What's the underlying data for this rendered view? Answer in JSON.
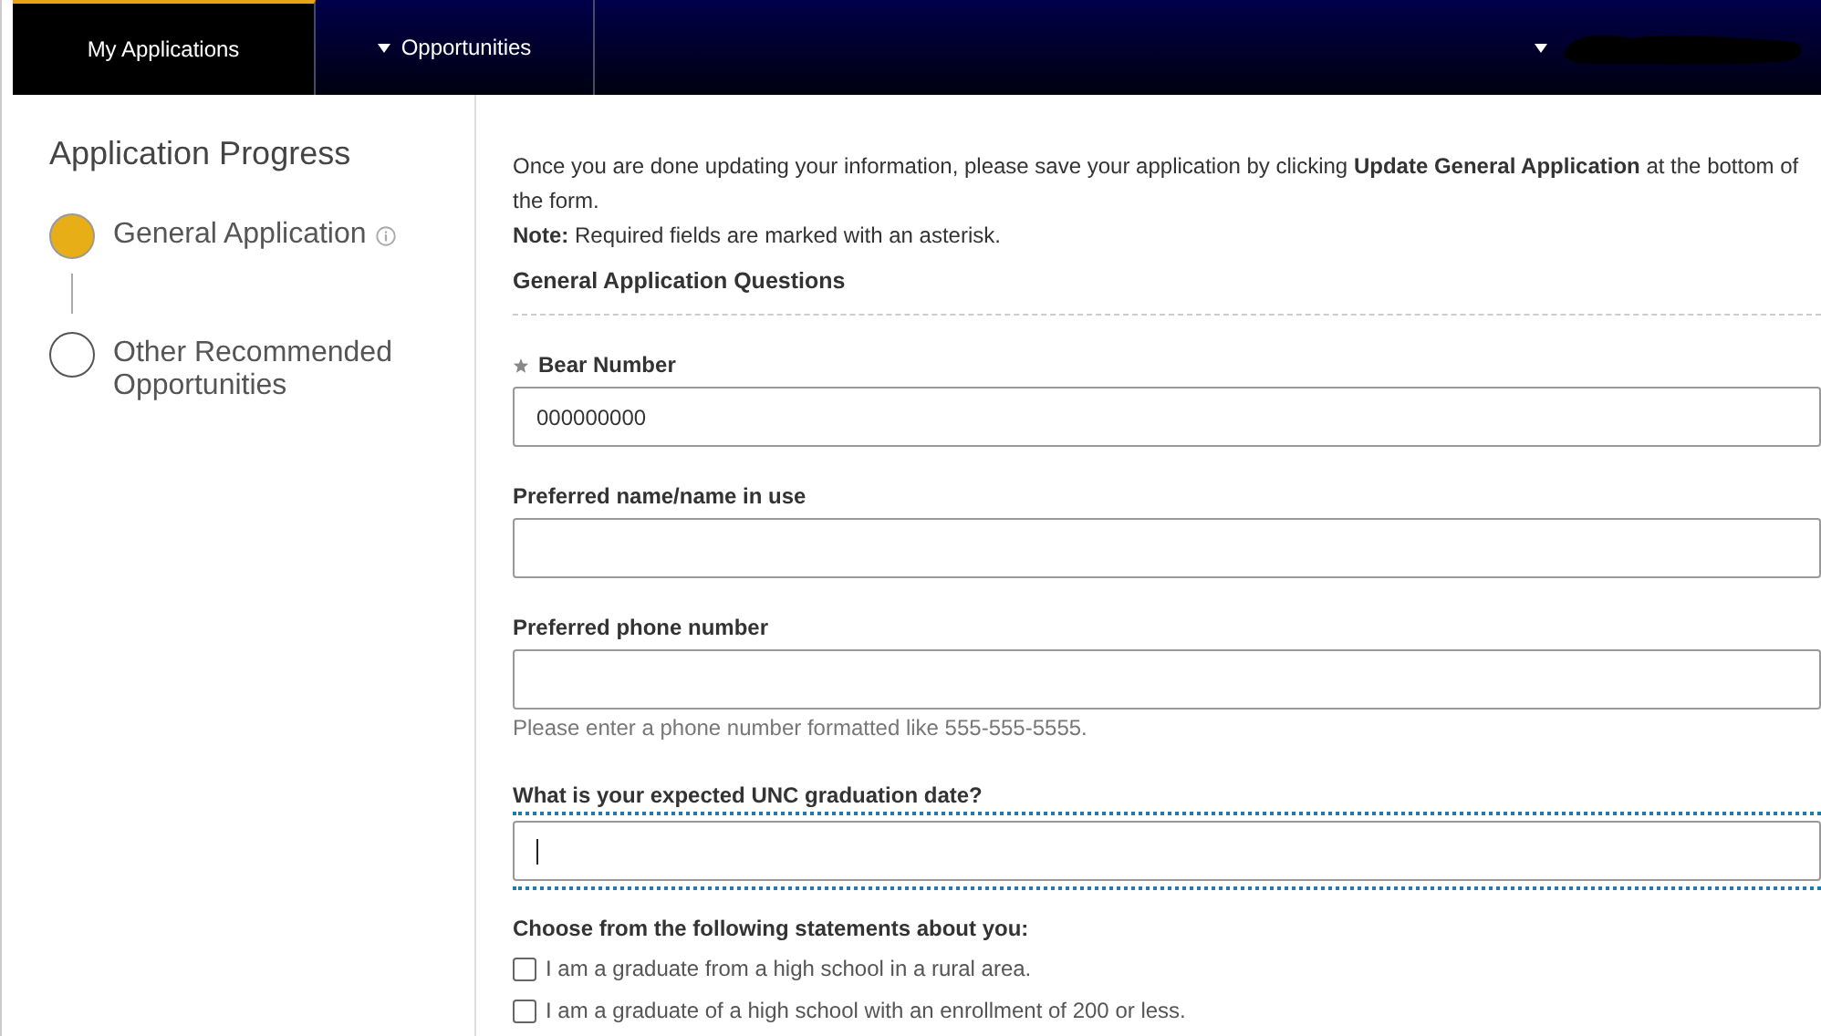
{
  "nav": {
    "tabs": [
      {
        "label": "My Applications",
        "selected": true,
        "dropdown": false
      },
      {
        "label": "Opportunities",
        "selected": false,
        "dropdown": true
      }
    ],
    "user_menu": {
      "redacted": true
    }
  },
  "sidebar": {
    "title": "Application Progress",
    "steps": [
      {
        "label": "General Application",
        "current": true,
        "info": true
      },
      {
        "label": "Other Recommended Opportunities",
        "current": false,
        "info": false
      }
    ]
  },
  "form": {
    "intro": "Once you are done updating your information, please save your application by clicking **Update General Application** at the bottom of the form.",
    "note": "**Note:** Required fields are marked with an asterisk.",
    "section_title": "General Application Questions",
    "fields": [
      {
        "label": "Bear Number",
        "required": true,
        "value": "000000000",
        "focused": false
      },
      {
        "label": "Preferred name/name in use",
        "required": false,
        "focused": false
      },
      {
        "label": "Preferred phone number",
        "required": false,
        "focused": false,
        "help": "Please enter a phone number formatted like 555-555-5555."
      },
      {
        "label": "What is your expected UNC graduation date?",
        "required": false,
        "focused": true
      }
    ],
    "statements": {
      "label": "Choose from the following statements about you:",
      "options": [
        {
          "label": "I am a graduate from a high school in a rural area.",
          "checked": false
        },
        {
          "label": "I am a graduate of a high school with an enrollment of 200 or less.",
          "checked": false
        }
      ]
    }
  }
}
